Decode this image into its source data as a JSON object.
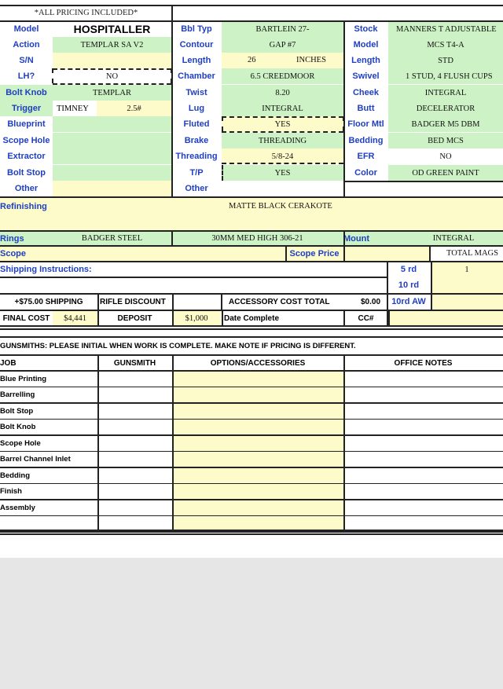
{
  "header": {
    "pricing_note": "*ALL PRICING INCLUDED*"
  },
  "col1": {
    "labels": [
      "Model",
      "Action",
      "S/N",
      "LH?",
      "Bolt Knob",
      "Trigger",
      "Blueprint",
      "Scope Hole",
      "Extractor",
      "Bolt Stop",
      "Other"
    ],
    "model": "HOSPITALLER",
    "action": "TEMPLAR SA V2",
    "lh": "NO",
    "bolt_knob": "TEMPLAR",
    "trigger_brand": "TIMNEY",
    "trigger_weight": "2.5#"
  },
  "col2": {
    "labels": [
      "Bbl Typ",
      "Contour",
      "Length",
      "Chamber",
      "Twist",
      "Lug",
      "Fluted",
      "Brake",
      "Threading",
      "T/P",
      "Other"
    ],
    "bbl_typ": "BARTLEIN 27-",
    "contour": "GAP #7",
    "length_value": "26",
    "length_unit": "INCHES",
    "chamber": "6.5 CREEDMOOR",
    "twist": "8.20",
    "lug": "INTEGRAL",
    "fluted": "YES",
    "brake": "THREADING",
    "threading": "5/8-24",
    "tp": "YES"
  },
  "col3": {
    "labels": [
      "Stock",
      "Model",
      "Length",
      "Swivel",
      "Cheek",
      "Butt",
      "Floor Mtl",
      "Bedding",
      "EFR",
      "Color"
    ],
    "stock": "MANNERS T ADJUSTABLE",
    "model": "MCS T4-A",
    "length": "STD",
    "swivel": "1 STUD, 4 FLUSH CUPS",
    "cheek": "INTEGRAL",
    "butt": "DECELERATOR",
    "floor_mtl": "BADGER M5 DBM",
    "bedding": "BED MCS",
    "efr": "NO",
    "color": "OD GREEN PAINT"
  },
  "refinishing": {
    "label": "Refinishing",
    "value": "MATTE BLACK CERAKOTE"
  },
  "rings": {
    "label": "Rings",
    "value": "BADGER STEEL",
    "height": "30MM MED HIGH 306-21"
  },
  "mount": {
    "label": "Mount",
    "value": "INTEGRAL"
  },
  "scope": {
    "label": "Scope",
    "price_label": "Scope Price"
  },
  "mags": {
    "header": "TOTAL MAGS",
    "rows": [
      {
        "label": "5 rd",
        "value": "1"
      },
      {
        "label": "10 rd",
        "value": ""
      },
      {
        "label": "10rd AW",
        "value": ""
      }
    ]
  },
  "shipping_instructions": {
    "label": "Shipping Instructions:"
  },
  "costs": {
    "shipping": "+$75.00 SHIPPING",
    "rifle_discount": "RIFLE DISCOUNT",
    "accessory_label": "ACCESSORY COST TOTAL",
    "accessory_value": "$0.00",
    "final_label": "FINAL COST",
    "final_value": "$4,441",
    "deposit_label": "DEPOSIT",
    "deposit_value": "$1,000",
    "date_complete": "Date Complete",
    "cc": "CC#"
  },
  "gunsmith_note": "GUNSMITHS:  PLEASE INITIAL WHEN WORK IS COMPLETE.  MAKE NOTE IF PRICING IS DIFFERENT.",
  "jobs": {
    "headers": [
      "JOB",
      "GUNSMITH",
      "OPTIONS/ACCESSORIES",
      "OFFICE NOTES"
    ],
    "items": [
      "Blue Printing",
      "Barrelling",
      "Bolt Stop",
      "Bolt Knob",
      "Scope Hole",
      "Barrel Channel Inlet",
      "Bedding",
      "Finish",
      "Assembly",
      ""
    ]
  }
}
